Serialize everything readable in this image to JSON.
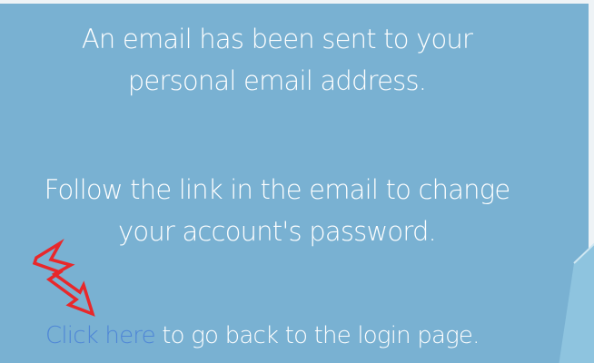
{
  "message": {
    "line1": "An email has been sent to your",
    "line2": "personal email address.",
    "line3": "Follow the link in the email to change",
    "line4": "your account's password."
  },
  "back_link": {
    "link_text": "Click here",
    "rest_text": " to go back to the login page."
  },
  "colors": {
    "panel_background": "#79b1d2",
    "text": "#ffffff",
    "link": "#4e86d6",
    "annotation": "#e8282b"
  },
  "icons": {
    "annotation": "red-lightning-arrow-icon"
  }
}
